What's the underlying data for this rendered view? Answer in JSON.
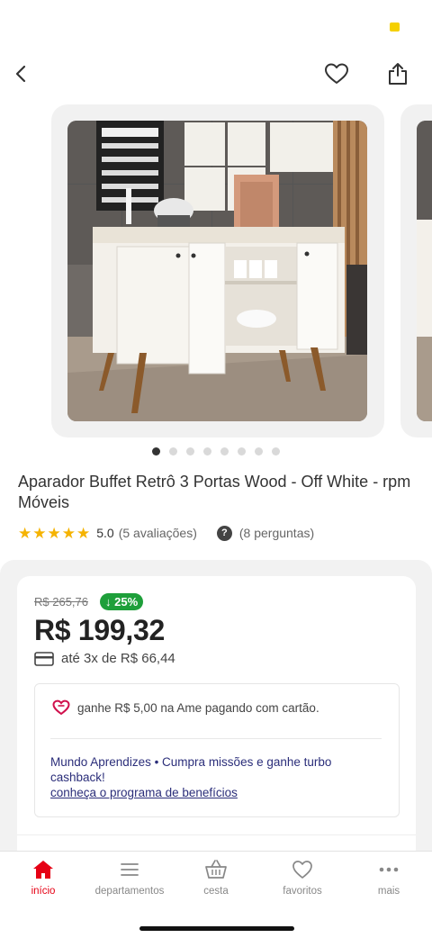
{
  "header": {
    "back_icon": "chevron-left-icon",
    "favorite_icon": "heart-outline-icon",
    "share_icon": "share-icon"
  },
  "gallery": {
    "image_count": 8,
    "active_index": 0
  },
  "product": {
    "title": "Aparador Buffet Retrô 3 Portas Wood - Off White - rpm Móveis",
    "rating_stars": 5,
    "rating_value": "5.0",
    "reviews_label": "(5 avaliações)",
    "questions_label": "(8 perguntas)"
  },
  "pricing": {
    "old_price": "R$ 265,76",
    "discount": "↓ 25%",
    "price": "R$ 199,32",
    "installments": "até 3x de R$ 66,44"
  },
  "benefits": {
    "ame_text": "ganhe R$ 5,00 na Ame pagando com cartão.",
    "mundo_text": "Mundo Aprendizes • Cumpra missões e ganhe turbo cashback!",
    "mundo_link": "conheça o programa de benefícios"
  },
  "bottom_nav": {
    "items": [
      {
        "label": "início",
        "icon": "home-icon",
        "active": true
      },
      {
        "label": "departamentos",
        "icon": "menu-icon",
        "active": false
      },
      {
        "label": "cesta",
        "icon": "basket-icon",
        "active": false
      },
      {
        "label": "favoritos",
        "icon": "heart-icon",
        "active": false
      },
      {
        "label": "mais",
        "icon": "more-icon",
        "active": false
      }
    ]
  },
  "colors": {
    "accent_red": "#e60014",
    "discount_green": "#1e9f3a",
    "link_blue": "#2b2e7a",
    "star_yellow": "#f5b301"
  }
}
